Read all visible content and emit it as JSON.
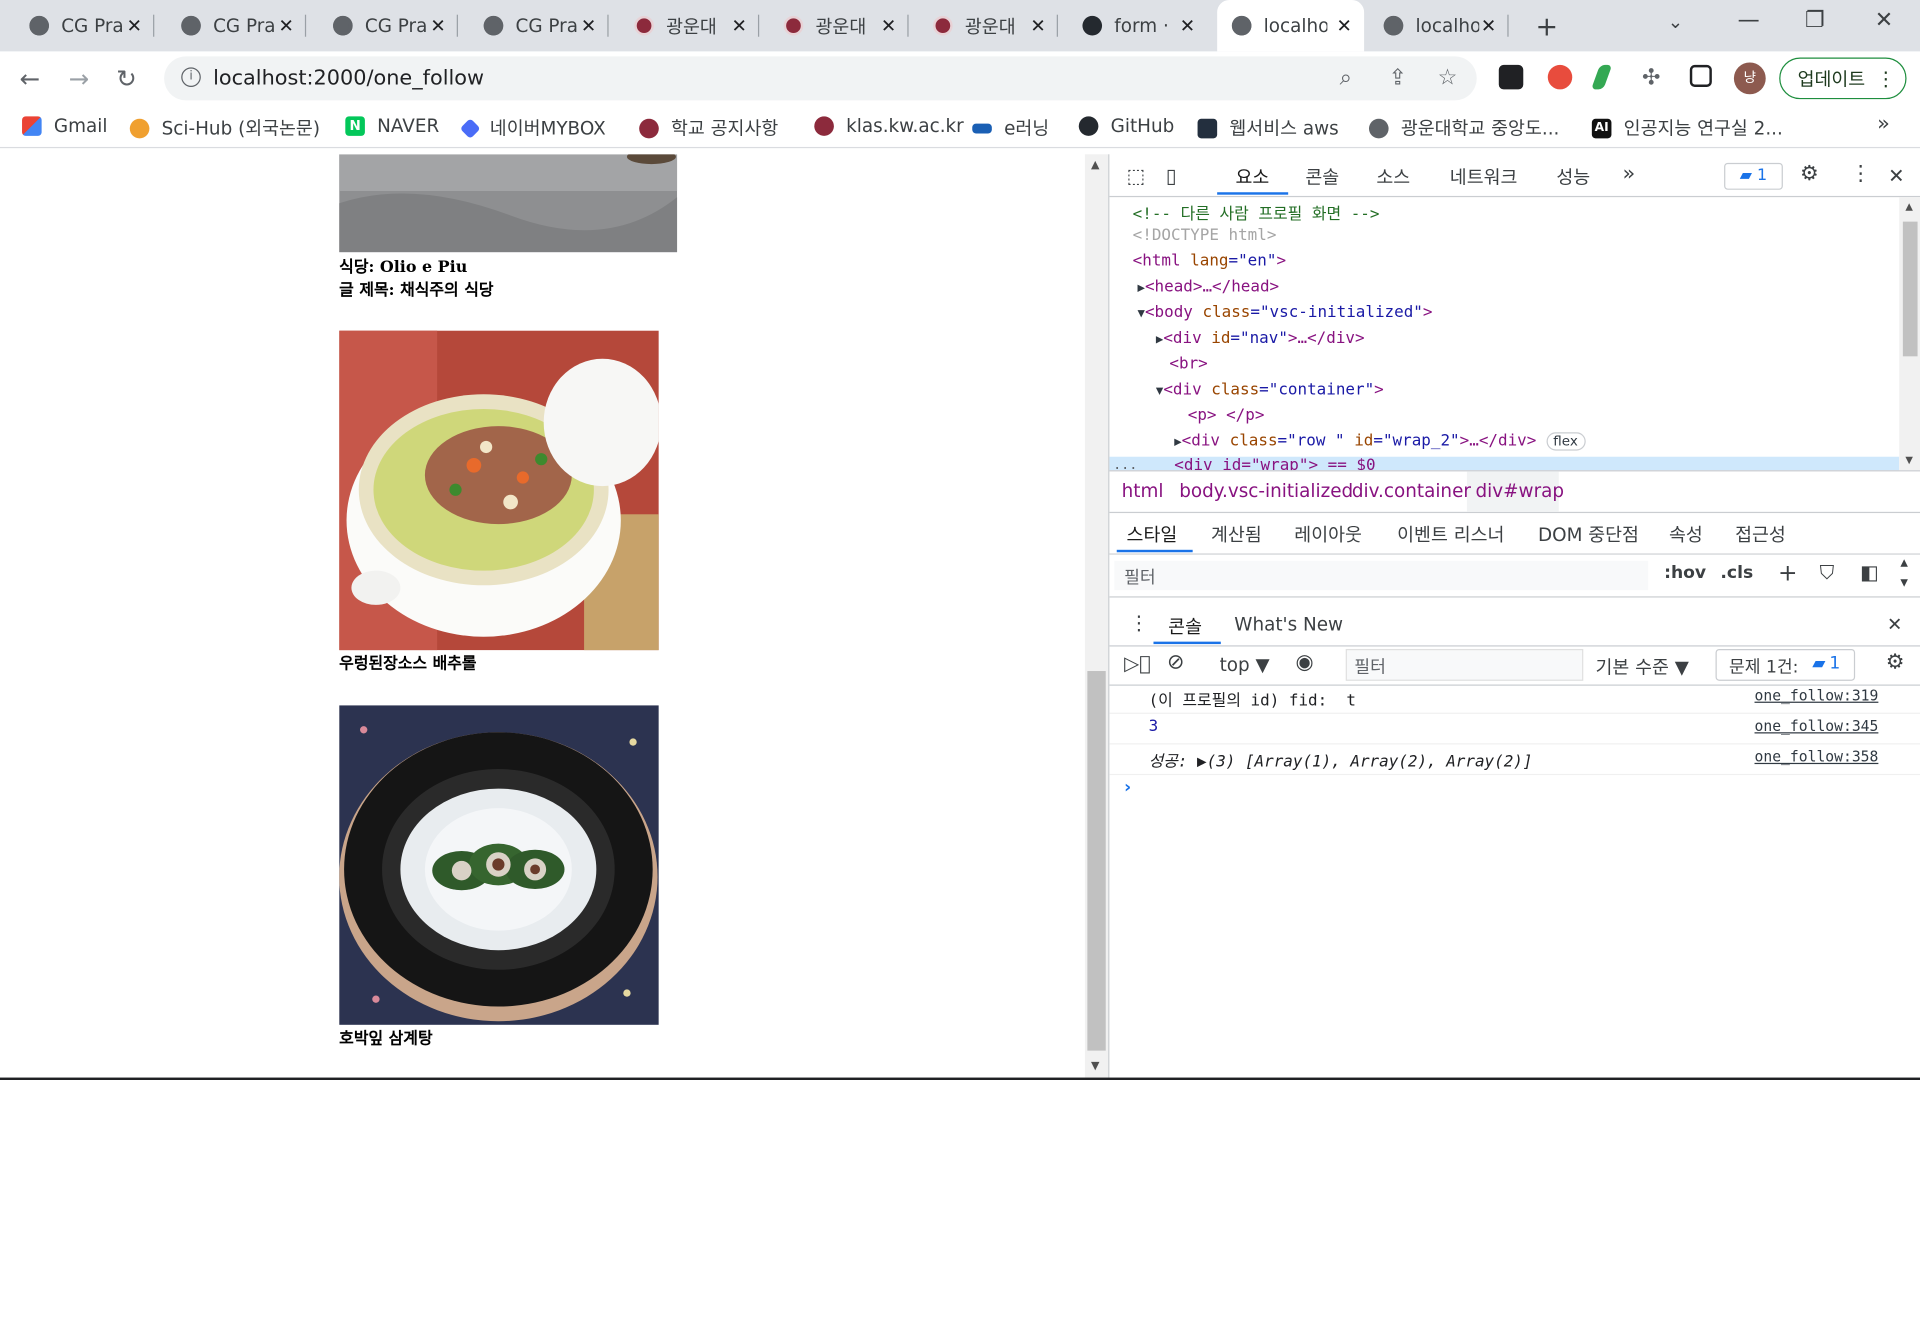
{
  "tabs": [
    {
      "title": "CG Pra",
      "icon": "globe-icon",
      "active": false
    },
    {
      "title": "CG Pra",
      "icon": "globe-icon",
      "active": false
    },
    {
      "title": "CG Pra",
      "icon": "globe-icon",
      "active": false
    },
    {
      "title": "CG Pra",
      "icon": "globe-icon",
      "active": false
    },
    {
      "title": "광운대",
      "icon": "kw-university-icon",
      "active": false
    },
    {
      "title": "광운대",
      "icon": "kw-university-icon",
      "active": false
    },
    {
      "title": "광운대",
      "icon": "kw-university-icon",
      "active": false
    },
    {
      "title": "form ·",
      "icon": "github-icon",
      "active": false
    },
    {
      "title": "localho",
      "icon": "globe-icon",
      "active": true
    },
    {
      "title": "localho",
      "icon": "globe-icon",
      "active": false
    }
  ],
  "toolbar": {
    "url": "localhost:2000/one_follow",
    "avatar_letter": "냥",
    "update_label": "업데이트"
  },
  "bookmarks": [
    {
      "label": "Gmail",
      "icon": "gmail-icon"
    },
    {
      "label": "Sci-Hub (외국논문)",
      "icon": "scihub-icon"
    },
    {
      "label": "NAVER",
      "icon": "naver-icon"
    },
    {
      "label": "네이버MYBOX",
      "icon": "mybox-icon"
    },
    {
      "label": "학교 공지사항",
      "icon": "kw-university-icon"
    },
    {
      "label": "klas.kw.ac.kr",
      "icon": "kw-university-icon"
    },
    {
      "label": "e러닝",
      "icon": "elearning-icon"
    },
    {
      "label": "GitHub",
      "icon": "github-icon"
    },
    {
      "label": "웹서비스 aws",
      "icon": "aws-icon"
    },
    {
      "label": "광운대학교 중앙도...",
      "icon": "globe-icon"
    },
    {
      "label": "인공지능 연구실 2...",
      "icon": "ai-lab-icon"
    }
  ],
  "page": {
    "card1": {
      "restaurant": "식당: Olio e Piu",
      "post_title": "글 제목: 채식주의 식당"
    },
    "card2": {
      "caption": "우렁된장소스 배추롤"
    },
    "card3": {
      "caption": "호박잎 삼계탕"
    }
  },
  "devtools": {
    "tabs": [
      "요소",
      "콘솔",
      "소스",
      "네트워크",
      "성능"
    ],
    "more": "»",
    "issue_count": "1",
    "elements": {
      "l1": "<!-- 다른 사람 프로필 화면 -->",
      "l2": "<!DOCTYPE html>",
      "l3a": "<html ",
      "l3b": "lang",
      "l3c": "=\"en\"",
      "l3d": ">",
      "l4": "<head>…</head>",
      "l5a": "<body ",
      "l5b": "class",
      "l5c": "=\"vsc-initialized\"",
      "l5d": ">",
      "l6a": "<div ",
      "l6b": "id",
      "l6c": "=\"nav\"",
      "l6d": ">…</div>",
      "l7": "<br>",
      "l8a": "<div ",
      "l8b": "class",
      "l8c": "=\"container\"",
      "l8d": ">",
      "l9": "<p> </p>",
      "l10a": "<div ",
      "l10b": "class",
      "l10c": "=\"row \" ",
      "l10b2": "id",
      "l10c2": "=\"wrap_2\"",
      "l10d": ">…</div>",
      "flex_pill": "flex",
      "l11": "<div id=\"wrap\"> == $0",
      "ellipsis": "..."
    },
    "breadcrumbs": [
      "html",
      "body.vsc-initialized",
      "div.container",
      "div#wrap"
    ],
    "style_tabs": [
      "스타일",
      "계산됨",
      "레이아웃",
      "이벤트 리스너",
      "DOM 중단점",
      "속성",
      "접근성"
    ],
    "style_filter_placeholder": "필터",
    "hov": ":hov",
    "cls": ".cls",
    "drawer_tabs": [
      "콘솔",
      "What's New"
    ],
    "console_toolbar": {
      "context": "top ▼",
      "filter_placeholder": "필터",
      "levels": "기본 수준 ▼",
      "issues": "문제 1건:",
      "issue_count": "1"
    },
    "console_messages": [
      {
        "text": "(이 프로필의 id) fid:  t",
        "source": "one_follow:319"
      },
      {
        "text": "3",
        "source": "one_follow:345"
      },
      {
        "text": "성공: ▶(3) [Array(1), Array(2), Array(2)]",
        "source": "one_follow:358"
      }
    ],
    "prompt": "›"
  }
}
